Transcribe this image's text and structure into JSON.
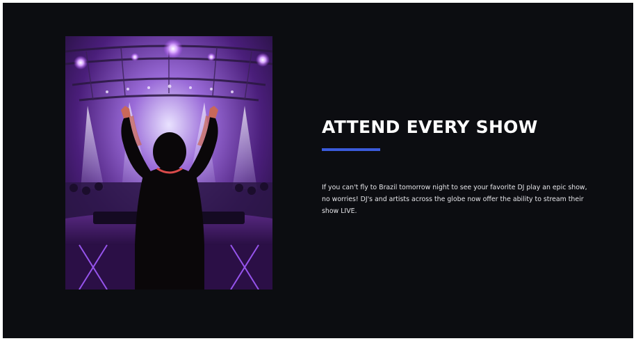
{
  "section": {
    "heading": "ATTEND EVERY SHOW",
    "body": "If you can't fly to Brazil tomorrow night to see your favorite DJ play an epic show, no worries! DJ's and artists across the globe now offer the ability to stream their show LIVE.",
    "accent_color": "#3b5bdb",
    "background_color": "#0c0d11"
  },
  "image": {
    "subject": "dj-concert-photo"
  }
}
